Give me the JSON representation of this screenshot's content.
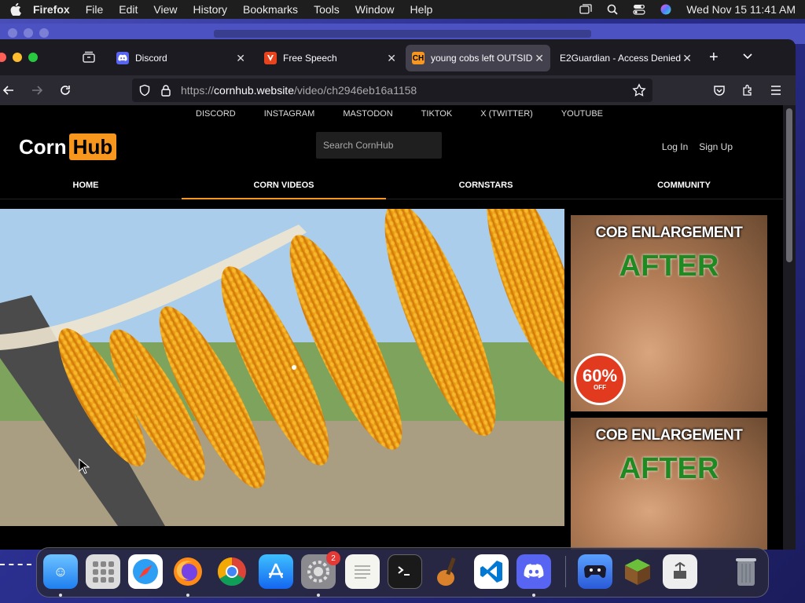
{
  "menubar": {
    "app_name": "Firefox",
    "items": [
      "File",
      "Edit",
      "View",
      "History",
      "Bookmarks",
      "Tools",
      "Window",
      "Help"
    ],
    "clock": "Wed Nov 15  11:41 AM"
  },
  "tabs": [
    {
      "label": "Discord",
      "favicon": "discord-icon",
      "color": "#5865f2"
    },
    {
      "label": "Free Speech",
      "favicon": "free-speech-icon",
      "color": "#e8431c"
    },
    {
      "label": "young cobs left OUTSIDE",
      "favicon": "CH",
      "color": "#f7971d",
      "active": true
    },
    {
      "label": "E2Guardian - Access Denied",
      "favicon": "",
      "color": ""
    }
  ],
  "urlbar": {
    "prefix": "https://",
    "domain": "cornhub.website",
    "path": "/video/ch2946eb16a1158"
  },
  "site": {
    "social_links": [
      "DISCORD",
      "INSTAGRAM",
      "MASTODON",
      "TIKTOK",
      "X (TWITTER)",
      "YOUTUBE"
    ],
    "logo_left": "Corn",
    "logo_right": "Hub",
    "search_placeholder": "Search CornHub",
    "login": "Log In",
    "signup": "Sign Up",
    "nav": [
      "HOME",
      "CORN VIDEOS",
      "CORNSTARS",
      "COMMUNITY"
    ],
    "active_nav": 1
  },
  "ads": [
    {
      "title": "COB ENLARGEMENT",
      "subtitle": "AFTER",
      "badge_pct": "60%",
      "badge_off": "OFF"
    },
    {
      "title": "COB ENLARGEMENT",
      "subtitle": "AFTER"
    }
  ],
  "dock": {
    "items": [
      "Finder",
      "Launchpad",
      "Safari",
      "Firefox",
      "Chrome",
      "App Store",
      "System Settings",
      "TextEdit",
      "Terminal",
      "GarageBand",
      "VS Code",
      "Discord",
      "Game Controller",
      "Minecraft",
      "Automator",
      "Trash"
    ],
    "settings_badge": "2"
  },
  "colors": {
    "accent": "#f7971d",
    "tab_active": "#42414d"
  }
}
